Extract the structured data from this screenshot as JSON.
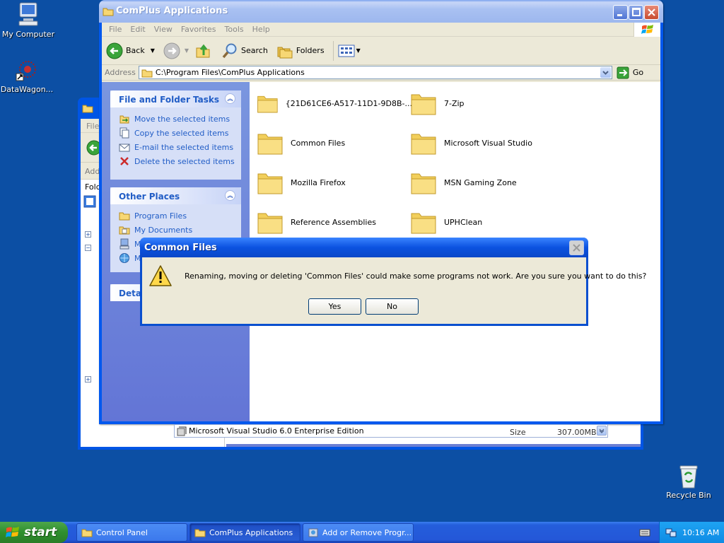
{
  "desktop": {
    "icons": [
      {
        "label": "My Computer"
      },
      {
        "label": "DataWagon..."
      },
      {
        "label": "Recycle Bin"
      }
    ]
  },
  "back_window": {
    "title": "Add or Remove Programs",
    "menu_first": "File",
    "address_label": "Add",
    "folders_label": "Fold",
    "program_entry": "Microsoft Visual Studio 6.0 Enterprise Edition",
    "size_label": "Size",
    "size_value": "307.00MB"
  },
  "main_window": {
    "title": "ComPlus Applications",
    "menu": [
      "File",
      "Edit",
      "View",
      "Favorites",
      "Tools",
      "Help"
    ],
    "toolbar": {
      "back": "Back",
      "search": "Search",
      "folders": "Folders"
    },
    "address": {
      "label": "Address",
      "value": "C:\\Program Files\\ComPlus Applications",
      "go": "Go"
    },
    "tasks_panel": {
      "title": "File and Folder Tasks",
      "items": [
        "Move the selected items",
        "Copy the selected items",
        "E-mail the selected items",
        "Delete the selected items"
      ]
    },
    "places_panel": {
      "title": "Other Places",
      "items": [
        "Program Files",
        "My Documents",
        "M",
        "M"
      ]
    },
    "details_panel": {
      "title": "Detai"
    },
    "folders": [
      "{21D61CE6-A517-11D1-9D8B-...",
      "7-Zip",
      "Common Files",
      "Microsoft Visual Studio",
      "Mozilla Firefox",
      "MSN Gaming Zone",
      "Reference Assemblies",
      "UPHClean"
    ]
  },
  "dialog": {
    "title": "Common Files",
    "message": "Renaming, moving or deleting 'Common Files' could make some programs not work. Are you sure you want to do this?",
    "yes": "Yes",
    "no": "No"
  },
  "taskbar": {
    "start": "start",
    "tasks": [
      "Control Panel",
      "ComPlus Applications",
      "Add or Remove Progr..."
    ],
    "clock": "10:16 AM"
  },
  "colors": {
    "desktop": "#0c4fa4",
    "titlebar": "#0a4fcf",
    "task_link": "#215dc6"
  }
}
